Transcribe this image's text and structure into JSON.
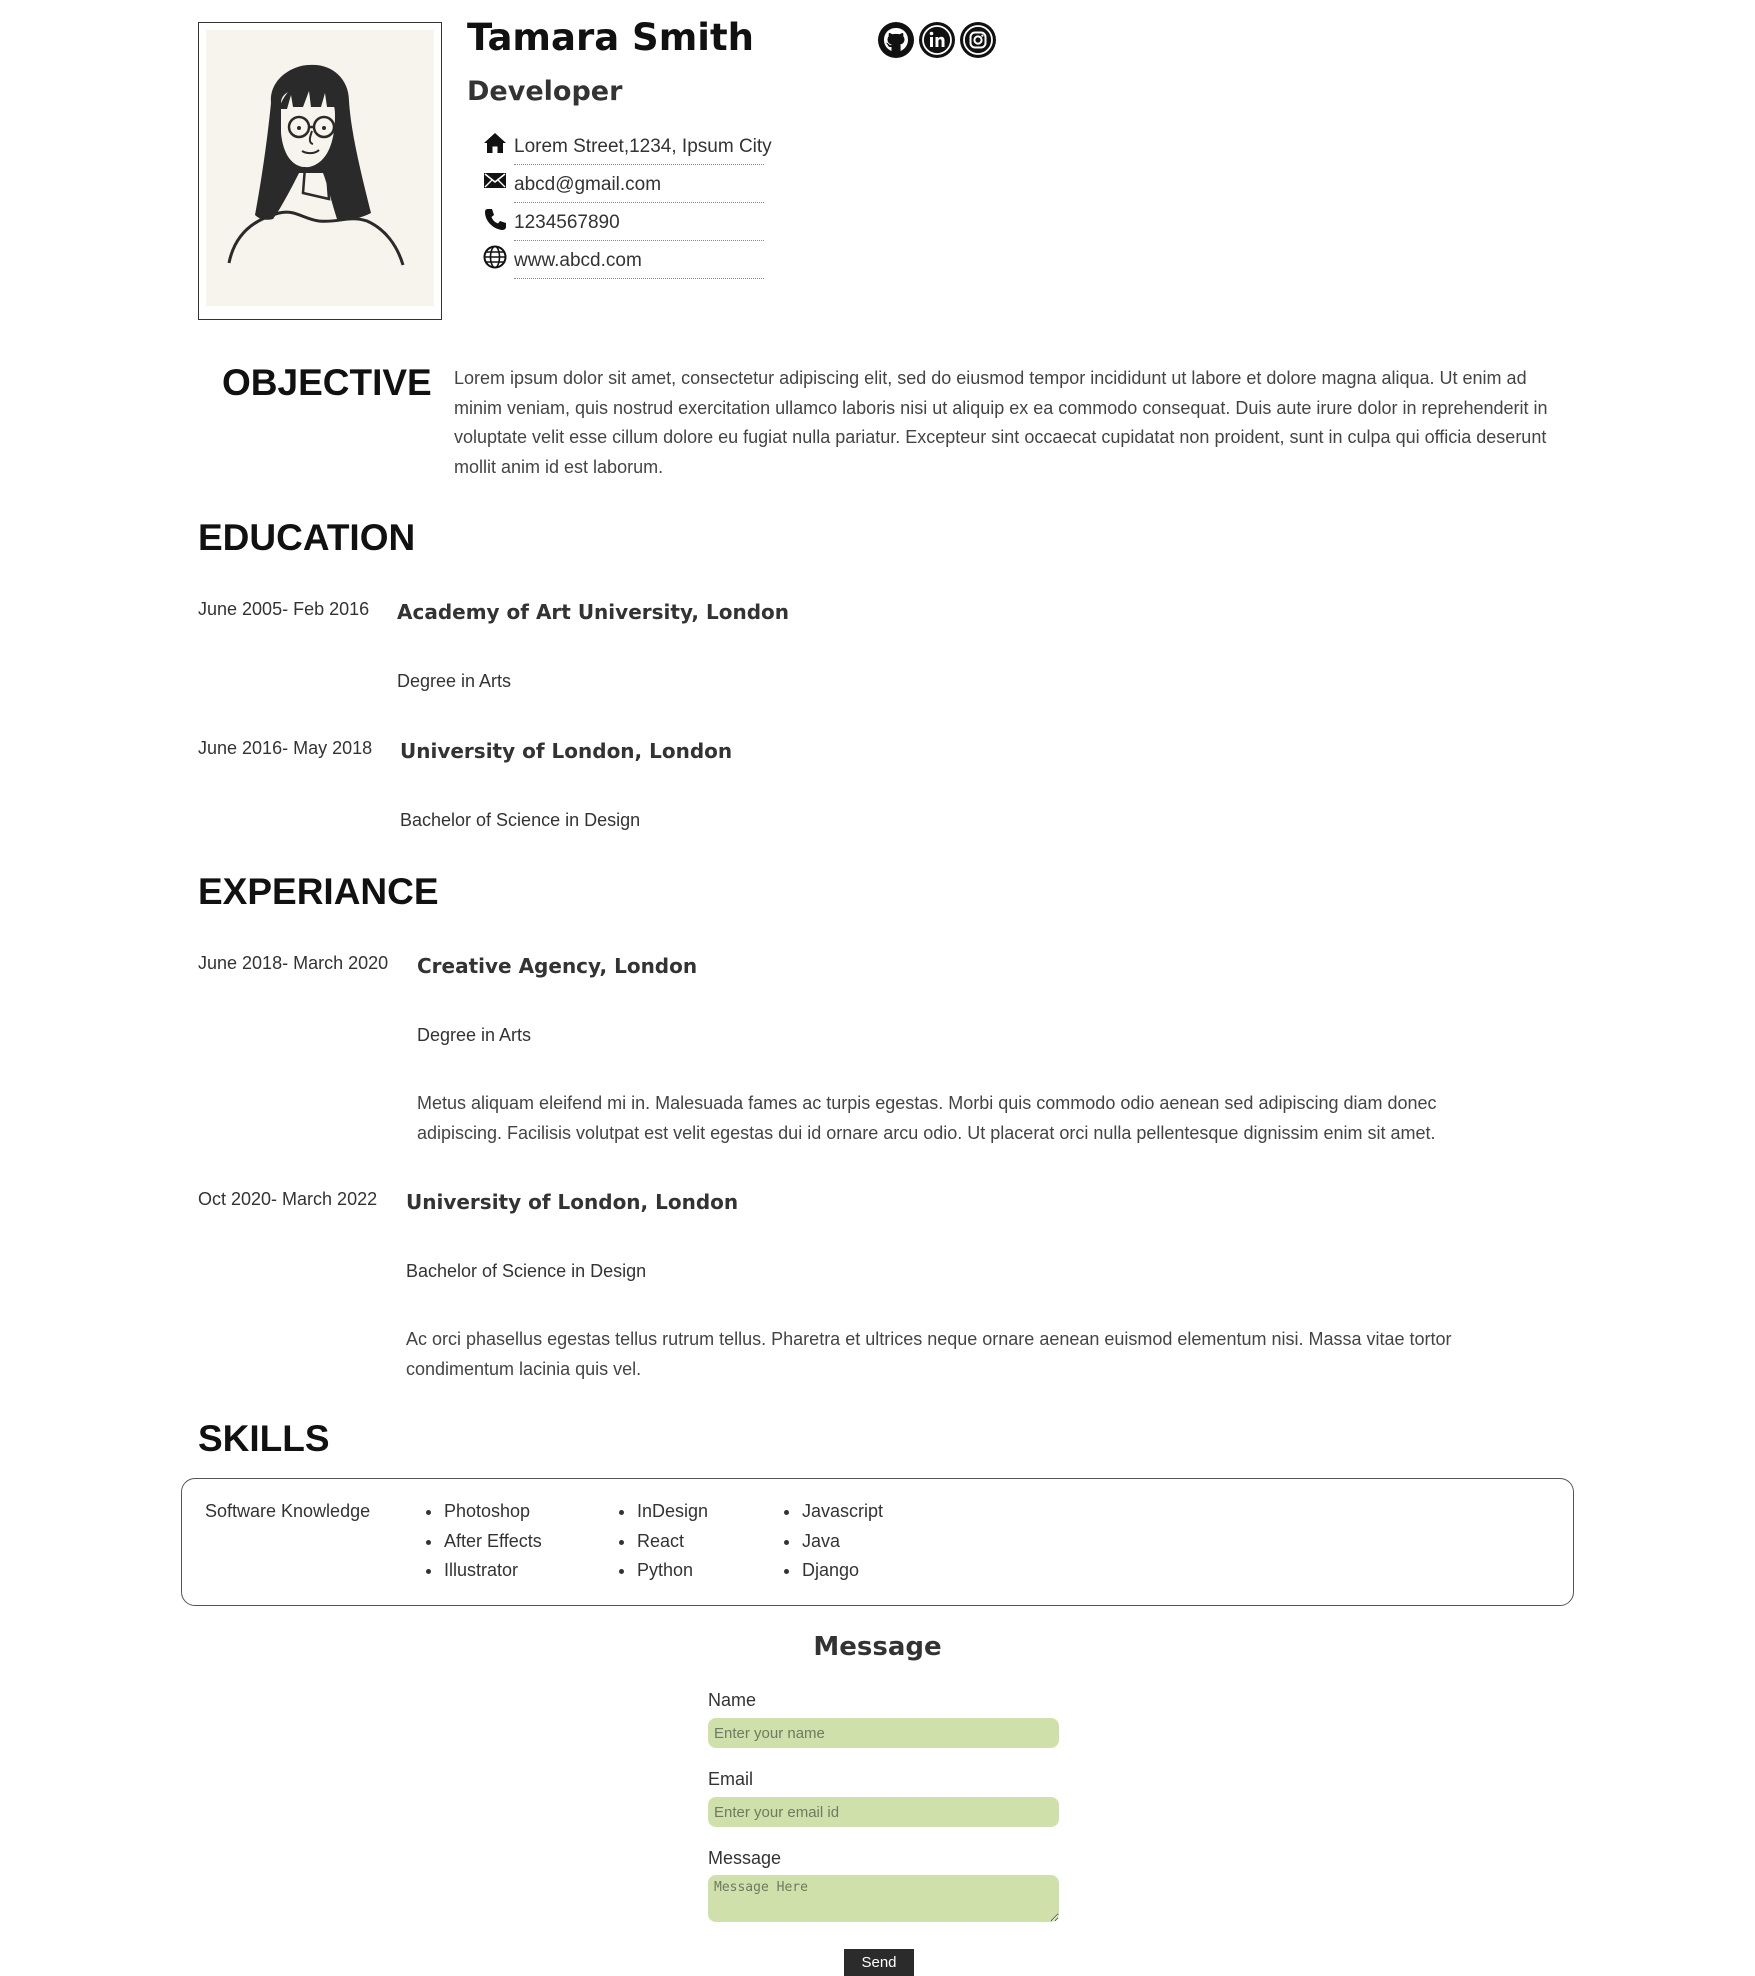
{
  "profile": {
    "name": "Tamara Smith",
    "role": "Developer",
    "photo_icon": "avatar-illustration",
    "socials": [
      {
        "icon": "github-icon"
      },
      {
        "icon": "linkedin-icon"
      },
      {
        "icon": "instagram-icon"
      }
    ],
    "contact": {
      "address": "Lorem Street,1234, Ipsum City",
      "email": "abcd@gmail.com",
      "phone": "1234567890",
      "website": "www.abcd.com"
    }
  },
  "objective": {
    "title": "OBJECTIVE",
    "text": "Lorem ipsum dolor sit amet, consectetur adipiscing elit, sed do eiusmod tempor incididunt ut labore et dolore magna aliqua. Ut enim ad minim veniam, quis nostrud exercitation ullamco laboris nisi ut aliquip ex ea commodo consequat. Duis aute irure dolor in reprehenderit in voluptate velit esse cillum dolore eu fugiat nulla pariatur. Excepteur sint occaecat cupidatat non proident, sunt in culpa qui officia deserunt mollit anim id est laborum."
  },
  "education": {
    "title": "EDUCATION",
    "items": [
      {
        "date": "June 2005- Feb 2016",
        "institution": "Academy of Art University, London",
        "degree": "Degree in Arts"
      },
      {
        "date": "June 2016- May 2018",
        "institution": "University of London, London",
        "degree": "Bachelor of Science in Design"
      }
    ]
  },
  "experience": {
    "title": "EXPERIANCE",
    "items": [
      {
        "date": "June 2018- March 2020",
        "institution": "Creative Agency, London",
        "degree": "Degree in Arts",
        "description": "Metus aliquam eleifend mi in. Malesuada fames ac turpis egestas. Morbi quis commodo odio aenean sed adipiscing diam donec adipiscing. Facilisis volutpat est velit egestas dui id ornare arcu odio. Ut placerat orci nulla pellentesque dignissim enim sit amet."
      },
      {
        "date": "Oct 2020- March 2022",
        "institution": "University of London, London",
        "degree": "Bachelor of Science in Design",
        "description": "Ac orci phasellus egestas tellus rutrum tellus. Pharetra et ultrices neque ornare aenean euismod elementum nisi. Massa vitae tortor condimentum lacinia quis vel."
      }
    ]
  },
  "skills": {
    "title": "SKILLS",
    "label": "Software Knowledge",
    "columns": [
      [
        "Photoshop",
        "After Effects",
        "Illustrator"
      ],
      [
        "InDesign",
        "React",
        "Python"
      ],
      [
        "Javascript",
        "Java",
        "Django"
      ]
    ]
  },
  "form": {
    "title": "Message",
    "name_label": "Name",
    "name_placeholder": "Enter your name",
    "email_label": "Email",
    "email_placeholder": "Enter your email id",
    "message_label": "Message",
    "message_placeholder": "Message Here",
    "send_label": "Send"
  },
  "colors": {
    "input_bg": "#d0e0aa",
    "button_bg": "#2b2b2b",
    "heading": "#111111",
    "text": "#333333"
  }
}
